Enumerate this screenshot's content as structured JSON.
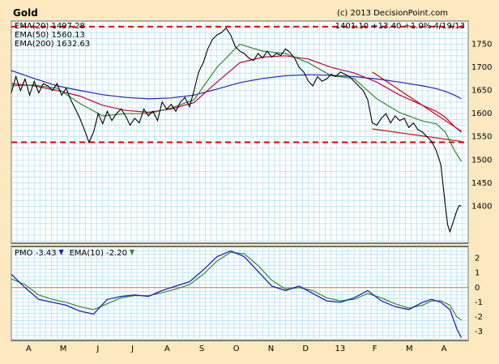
{
  "chart_data": [
    {
      "type": "line",
      "title": "Gold",
      "source": "(c) 2013 DecisionPoint.com",
      "quote": "1401.10  +13.40  +1.0%  4/19/13",
      "ylim": [
        1320,
        1800
      ],
      "yticks": [
        1400,
        1450,
        1500,
        1550,
        1600,
        1650,
        1700,
        1750
      ],
      "xtick_labels": [
        "A",
        "M",
        "J",
        "J",
        "A",
        "S",
        "O",
        "N",
        "D",
        "13",
        "F",
        "M",
        "A"
      ],
      "grid": true,
      "legend": [
        {
          "label": "EMA(20) 1497.28",
          "color": "#2e8b2e"
        },
        {
          "label": "EMA(50) 1560.13",
          "color": "#c0003c"
        },
        {
          "label": "EMA(200) 1632.63",
          "color": "#2020c0"
        }
      ],
      "annotations": [
        {
          "type": "horizontal-dashed-line",
          "y": 1788,
          "color": "#e00000"
        },
        {
          "type": "horizontal-dashed-line",
          "y": 1538,
          "color": "#e00000"
        },
        {
          "type": "trendline",
          "x": [
            0.79,
            0.985
          ],
          "y": [
            1567,
            1540
          ],
          "color": "#e00000"
        },
        {
          "type": "trendline",
          "x": [
            0.79,
            0.985
          ],
          "y": [
            1690,
            1562
          ],
          "color": "#e00000"
        }
      ],
      "series": [
        {
          "name": "Gold",
          "color": "#000000",
          "x": [
            0,
            0.01,
            0.02,
            0.03,
            0.04,
            0.05,
            0.06,
            0.07,
            0.08,
            0.09,
            0.1,
            0.11,
            0.12,
            0.13,
            0.14,
            0.15,
            0.16,
            0.17,
            0.18,
            0.19,
            0.2,
            0.21,
            0.22,
            0.23,
            0.24,
            0.25,
            0.26,
            0.27,
            0.28,
            0.29,
            0.3,
            0.31,
            0.32,
            0.33,
            0.34,
            0.35,
            0.36,
            0.37,
            0.38,
            0.39,
            0.4,
            0.41,
            0.42,
            0.43,
            0.44,
            0.45,
            0.46,
            0.47,
            0.48,
            0.49,
            0.5,
            0.51,
            0.52,
            0.53,
            0.54,
            0.55,
            0.56,
            0.57,
            0.58,
            0.59,
            0.6,
            0.61,
            0.62,
            0.63,
            0.64,
            0.65,
            0.66,
            0.67,
            0.68,
            0.69,
            0.7,
            0.71,
            0.72,
            0.73,
            0.74,
            0.75,
            0.76,
            0.77,
            0.78,
            0.79,
            0.8,
            0.81,
            0.82,
            0.83,
            0.84,
            0.85,
            0.86,
            0.87,
            0.88,
            0.89,
            0.9,
            0.91,
            0.92,
            0.93,
            0.94,
            0.95,
            0.955,
            0.96,
            0.965,
            0.97,
            0.975,
            0.98,
            0.985
          ],
          "y": [
            1645,
            1680,
            1650,
            1675,
            1640,
            1670,
            1645,
            1665,
            1660,
            1650,
            1665,
            1640,
            1655,
            1630,
            1610,
            1590,
            1565,
            1538,
            1560,
            1600,
            1578,
            1605,
            1585,
            1600,
            1610,
            1595,
            1575,
            1590,
            1580,
            1610,
            1595,
            1605,
            1585,
            1625,
            1610,
            1620,
            1605,
            1625,
            1635,
            1615,
            1650,
            1690,
            1710,
            1740,
            1760,
            1770,
            1775,
            1785,
            1770,
            1745,
            1735,
            1730,
            1720,
            1715,
            1730,
            1720,
            1735,
            1722,
            1730,
            1726,
            1740,
            1732,
            1720,
            1700,
            1690,
            1670,
            1660,
            1680,
            1670,
            1675,
            1685,
            1680,
            1690,
            1685,
            1680,
            1670,
            1660,
            1650,
            1630,
            1580,
            1575,
            1590,
            1600,
            1580,
            1595,
            1585,
            1590,
            1570,
            1580,
            1565,
            1560,
            1550,
            1540,
            1520,
            1490,
            1400,
            1360,
            1345,
            1360,
            1375,
            1390,
            1401,
            1401
          ]
        },
        {
          "name": "EMA(20)",
          "color": "#2e8b2e",
          "x": [
            0,
            0.05,
            0.1,
            0.15,
            0.2,
            0.25,
            0.3,
            0.35,
            0.4,
            0.45,
            0.5,
            0.55,
            0.6,
            0.65,
            0.7,
            0.75,
            0.8,
            0.85,
            0.9,
            0.93,
            0.95,
            0.97,
            0.985
          ],
          "y": [
            1660,
            1662,
            1655,
            1622,
            1595,
            1600,
            1600,
            1612,
            1630,
            1700,
            1750,
            1735,
            1730,
            1710,
            1682,
            1676,
            1632,
            1602,
            1584,
            1578,
            1560,
            1520,
            1497
          ]
        },
        {
          "name": "EMA(50)",
          "color": "#c0003c",
          "x": [
            0,
            0.05,
            0.1,
            0.15,
            0.2,
            0.25,
            0.3,
            0.35,
            0.4,
            0.45,
            0.5,
            0.55,
            0.6,
            0.65,
            0.7,
            0.75,
            0.8,
            0.85,
            0.9,
            0.93,
            0.95,
            0.97,
            0.985
          ],
          "y": [
            1665,
            1660,
            1650,
            1638,
            1618,
            1607,
            1603,
            1610,
            1624,
            1668,
            1710,
            1722,
            1725,
            1718,
            1700,
            1688,
            1668,
            1640,
            1618,
            1605,
            1592,
            1572,
            1560
          ]
        },
        {
          "name": "EMA(200)",
          "color": "#2020c0",
          "x": [
            0,
            0.05,
            0.1,
            0.15,
            0.2,
            0.25,
            0.3,
            0.35,
            0.4,
            0.45,
            0.5,
            0.55,
            0.6,
            0.65,
            0.7,
            0.75,
            0.8,
            0.85,
            0.9,
            0.93,
            0.95,
            0.97,
            0.985
          ],
          "y": [
            1693,
            1676,
            1660,
            1650,
            1641,
            1635,
            1632,
            1634,
            1640,
            1653,
            1667,
            1676,
            1682,
            1684,
            1683,
            1680,
            1675,
            1668,
            1660,
            1654,
            1648,
            1640,
            1632
          ]
        }
      ]
    },
    {
      "type": "line",
      "legend": [
        {
          "label": "PMO -3.43",
          "color": "#2020c0",
          "arrow": "down"
        },
        {
          "label": "EMA(10) -2.20",
          "color": "#2e8b2e",
          "arrow": "down"
        }
      ],
      "ylim": [
        -3.6,
        2.8
      ],
      "yticks": [
        -3,
        -2,
        -1,
        0,
        1,
        2
      ],
      "zero_line": {
        "y": 0,
        "color": "#d08000"
      },
      "series": [
        {
          "name": "PMO",
          "color": "#2020c0",
          "x": [
            0,
            0.03,
            0.06,
            0.09,
            0.12,
            0.15,
            0.18,
            0.21,
            0.24,
            0.27,
            0.3,
            0.33,
            0.36,
            0.39,
            0.42,
            0.45,
            0.48,
            0.51,
            0.54,
            0.57,
            0.6,
            0.63,
            0.66,
            0.69,
            0.72,
            0.75,
            0.78,
            0.81,
            0.84,
            0.87,
            0.9,
            0.92,
            0.94,
            0.96,
            0.975,
            0.985
          ],
          "y": [
            0.9,
            0.0,
            -0.8,
            -1.0,
            -1.2,
            -1.6,
            -1.8,
            -0.8,
            -0.6,
            -0.5,
            -0.6,
            -0.2,
            0.1,
            0.4,
            1.2,
            2.1,
            2.5,
            2.1,
            1.1,
            0.1,
            -0.2,
            0.1,
            -0.4,
            -0.9,
            -1.0,
            -0.7,
            -0.2,
            -0.9,
            -1.3,
            -1.5,
            -1.0,
            -0.8,
            -1.0,
            -1.5,
            -2.8,
            -3.4
          ]
        },
        {
          "name": "EMA(10)",
          "color": "#2e8b2e",
          "x": [
            0,
            0.03,
            0.06,
            0.09,
            0.12,
            0.15,
            0.18,
            0.21,
            0.24,
            0.27,
            0.3,
            0.33,
            0.36,
            0.39,
            0.42,
            0.45,
            0.48,
            0.51,
            0.54,
            0.57,
            0.6,
            0.63,
            0.66,
            0.69,
            0.72,
            0.75,
            0.78,
            0.81,
            0.84,
            0.87,
            0.9,
            0.92,
            0.94,
            0.96,
            0.975,
            0.985
          ],
          "y": [
            0.6,
            0.2,
            -0.5,
            -0.8,
            -1.0,
            -1.3,
            -1.5,
            -1.1,
            -0.7,
            -0.55,
            -0.55,
            -0.35,
            -0.1,
            0.2,
            0.9,
            1.8,
            2.4,
            2.3,
            1.5,
            0.5,
            -0.1,
            0.0,
            -0.2,
            -0.7,
            -0.9,
            -0.8,
            -0.4,
            -0.7,
            -1.1,
            -1.4,
            -1.2,
            -0.9,
            -0.9,
            -1.2,
            -2.0,
            -2.2
          ]
        }
      ]
    }
  ]
}
